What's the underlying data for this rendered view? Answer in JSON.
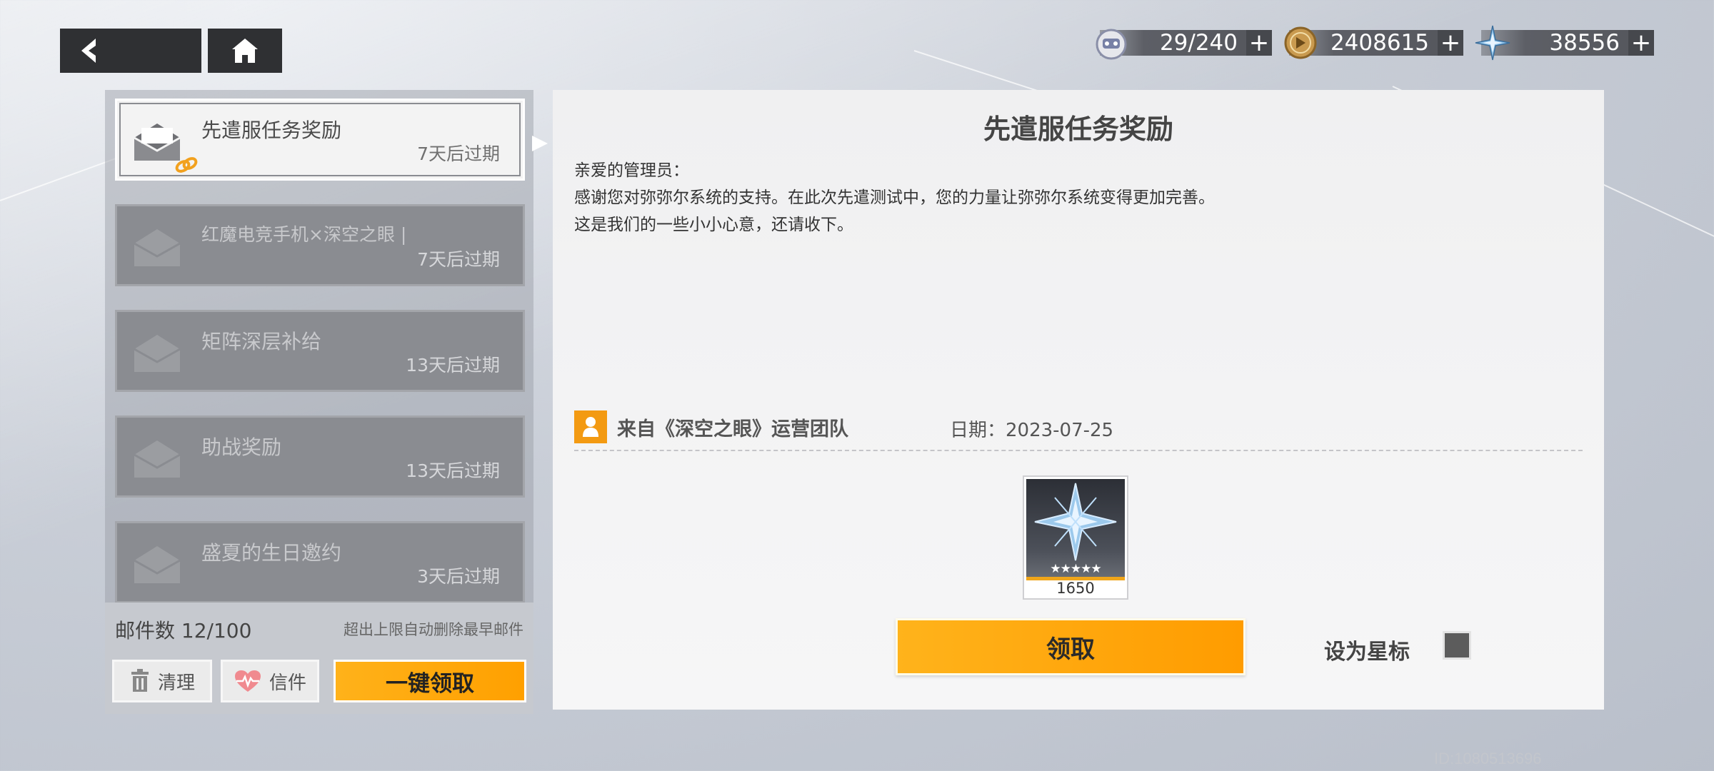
{
  "nav": {
    "back_icon": "back-arrow-icon",
    "home_icon": "home-icon"
  },
  "currencies": [
    {
      "icon": "stamina-icon",
      "value": "29/240"
    },
    {
      "icon": "coin-icon",
      "value": "2408615"
    },
    {
      "icon": "crystal-icon",
      "value": "38556"
    }
  ],
  "mail_list": [
    {
      "title": "先遣服任务奖励",
      "expire": "7天后过期",
      "active": true,
      "has_attachment": true
    },
    {
      "title": "红魔电竞手机×深空之眼 |",
      "expire": "7天后过期",
      "active": false
    },
    {
      "title": "矩阵深层补给",
      "expire": "13天后过期",
      "active": false
    },
    {
      "title": "助战奖励",
      "expire": "13天后过期",
      "active": false
    },
    {
      "title": "盛夏的生日邀约",
      "expire": "3天后过期",
      "active": false
    }
  ],
  "footer": {
    "count_label": "邮件数 12/100",
    "limit_note": "超出上限自动删除最早邮件",
    "clean_label": "清理",
    "letter_label": "信件",
    "claim_all_label": "一键领取"
  },
  "detail": {
    "title": "先遣服任务奖励",
    "body": [
      "亲爱的管理员：",
      "感谢您对弥弥尔系统的支持。在此次先遣测试中，您的力量让弥弥尔系统变得更加完善。",
      "这是我们的一些小小心意，还请收下。"
    ],
    "sender": "来自《深空之眼》运营团队",
    "date": "日期：2023-07-25",
    "reward": {
      "icon": "crystal-icon",
      "stars": "★★★★★",
      "quantity": "1650"
    },
    "claim_label": "领取",
    "star_label": "设为星标"
  },
  "uid": "ID:1080513696",
  "colors": {
    "accent": "#ffa500",
    "sender_icon": "#f39a12"
  }
}
